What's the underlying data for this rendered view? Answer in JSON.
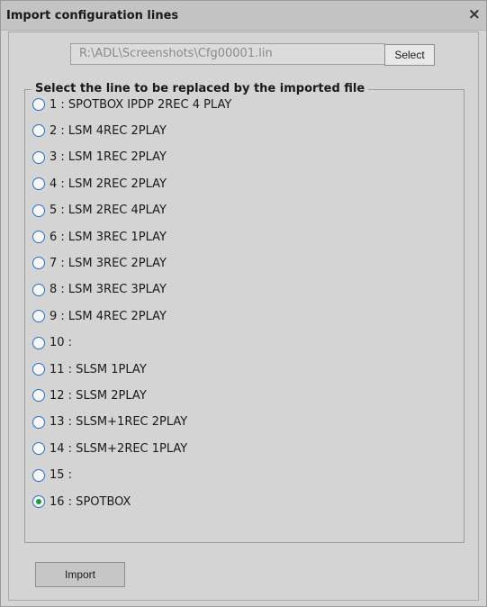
{
  "dialog": {
    "title": "Import configuration lines",
    "close_symbol": "×"
  },
  "file": {
    "path": "R:\\ADL\\Screenshots\\Cfg00001.lin",
    "select_label": "Select"
  },
  "group": {
    "legend": "Select the line to be replaced by the imported file"
  },
  "options": [
    {
      "label": "1 : SPOTBOX IPDP 2REC 4 PLAY",
      "checked": false
    },
    {
      "label": "2 : LSM 4REC 2PLAY",
      "checked": false
    },
    {
      "label": "3 : LSM 1REC 2PLAY",
      "checked": false
    },
    {
      "label": "4 : LSM 2REC 2PLAY",
      "checked": false
    },
    {
      "label": "5 : LSM 2REC 4PLAY",
      "checked": false
    },
    {
      "label": "6 : LSM 3REC 1PLAY",
      "checked": false
    },
    {
      "label": "7 : LSM 3REC 2PLAY",
      "checked": false
    },
    {
      "label": "8 : LSM 3REC 3PLAY",
      "checked": false
    },
    {
      "label": "9 : LSM 4REC 2PLAY",
      "checked": false
    },
    {
      "label": "10 :",
      "checked": false
    },
    {
      "label": "11 : SLSM 1PLAY",
      "checked": false
    },
    {
      "label": "12 : SLSM 2PLAY",
      "checked": false
    },
    {
      "label": "13 : SLSM+1REC 2PLAY",
      "checked": false
    },
    {
      "label": "14 : SLSM+2REC 1PLAY",
      "checked": false
    },
    {
      "label": "15 :",
      "checked": false
    },
    {
      "label": "16 : SPOTBOX",
      "checked": true
    }
  ],
  "actions": {
    "import_label": "Import"
  },
  "colors": {
    "radio_border": "#2a6fbf",
    "radio_checked_dot": "#1d9d3a",
    "dialog_background": "#d4d4d4"
  }
}
